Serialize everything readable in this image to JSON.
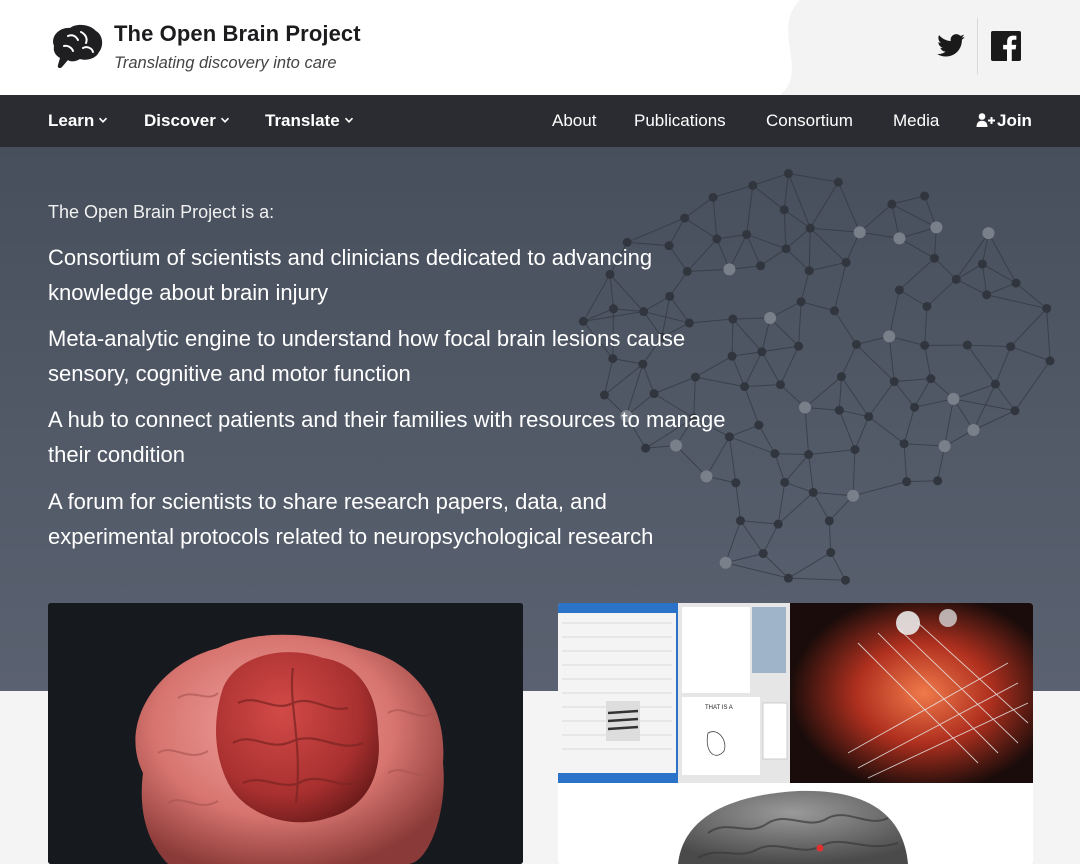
{
  "header": {
    "title": "The Open Brain Project",
    "tagline": "Translating discovery into care",
    "social": {
      "twitter_icon": "twitter-icon",
      "facebook_icon": "facebook-icon"
    }
  },
  "nav": {
    "left": [
      {
        "label": "Learn",
        "has_dropdown": true
      },
      {
        "label": "Discover",
        "has_dropdown": true
      },
      {
        "label": "Translate",
        "has_dropdown": true
      }
    ],
    "right": [
      {
        "label": "About"
      },
      {
        "label": "Publications"
      },
      {
        "label": "Consortium"
      },
      {
        "label": "Media"
      },
      {
        "label": "Join",
        "icon": "add-user-icon"
      }
    ]
  },
  "hero": {
    "intro": "The Open Brain Project is a:",
    "lines": [
      "Consortium of scientists and clinicians dedicated to advancing knowledge about brain injury",
      "Meta-analytic engine to understand how focal brain lesions cause sensory, cognitive and motor function",
      "A hub to connect patients and their families with resources to manage their condition",
      "A forum for scientists to share research papers, data, and experimental protocols related to neuropsychological research"
    ]
  },
  "cards": {
    "right_monitor_text": "THAT IS A"
  },
  "colors": {
    "navbar_bg": "#2b2c31",
    "hero_bg": "#4d5563",
    "brain_red": "#c8484a"
  }
}
